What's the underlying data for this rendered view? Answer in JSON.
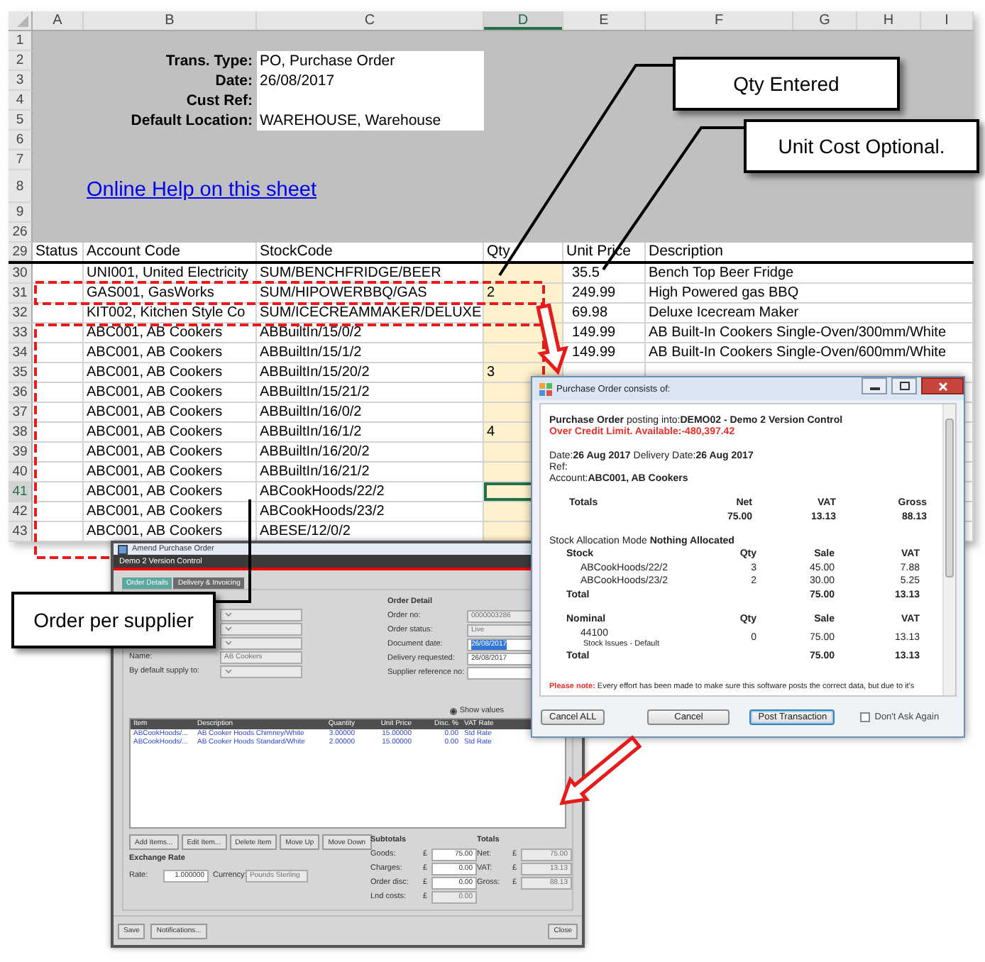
{
  "sheet": {
    "columns": [
      {
        "label": "A",
        "selected": false
      },
      {
        "label": "B",
        "selected": false
      },
      {
        "label": "C",
        "selected": false
      },
      {
        "label": "D",
        "selected": true
      },
      {
        "label": "E",
        "selected": false
      },
      {
        "label": "F",
        "selected": false
      },
      {
        "label": "G",
        "selected": false
      },
      {
        "label": "H",
        "selected": false
      },
      {
        "label": "I",
        "selected": false
      }
    ],
    "top_rows": [
      {
        "number": "1"
      },
      {
        "number": "2",
        "label": "Trans. Type:",
        "value": "PO, Purchase Order"
      },
      {
        "number": "3",
        "label": "Date:",
        "value": "26/08/2017"
      },
      {
        "number": "4",
        "label": "Cust Ref:"
      },
      {
        "number": "5",
        "label": "Default Location:",
        "value": "WAREHOUSE, Warehouse"
      },
      {
        "number": "6"
      },
      {
        "number": "7"
      },
      {
        "number": "8",
        "link": "Online Help on this sheet"
      },
      {
        "number": "9"
      },
      {
        "number": "26"
      }
    ],
    "header": {
      "number": "29",
      "cells": [
        "Status",
        "Account Code",
        "StockCode",
        "Qty",
        "Unit Price",
        "Description"
      ]
    },
    "rows": [
      {
        "number": "30",
        "account": "UNI001, United Electricity",
        "stock": "SUM/BENCHFRIDGE/BEER",
        "price": "35.5",
        "description": "Bench Top Beer Fridge",
        "selected": false
      },
      {
        "number": "31",
        "account": "GAS001, GasWorks",
        "stock": "SUM/HIPOWERBBQ/GAS",
        "qty": "2",
        "price": "249.99",
        "description": "High Powered gas BBQ",
        "selected": false
      },
      {
        "number": "32",
        "account": "KIT002, Kitchen Style Co",
        "stock": "SUM/ICECREAMMAKER/DELUXE",
        "price": "69.98",
        "description": "Deluxe Icecream Maker",
        "selected": false
      },
      {
        "number": "33",
        "account": "ABC001, AB Cookers",
        "stock": "ABBuiltIn/15/0/2",
        "price": "149.99",
        "description": "AB Built-In Cookers Single-Oven/300mm/White",
        "selected": false
      },
      {
        "number": "34",
        "account": "ABC001, AB Cookers",
        "stock": "ABBuiltIn/15/1/2",
        "price": "149.99",
        "description": "AB Built-In Cookers Single-Oven/600mm/White",
        "selected": false
      },
      {
        "number": "35",
        "account": "ABC001, AB Cookers",
        "stock": "ABBuiltIn/15/20/2",
        "qty": "3",
        "selected": false
      },
      {
        "number": "36",
        "account": "ABC001, AB Cookers",
        "stock": "ABBuiltIn/15/21/2",
        "selected": false
      },
      {
        "number": "37",
        "account": "ABC001, AB Cookers",
        "stock": "ABBuiltIn/16/0/2",
        "selected": false
      },
      {
        "number": "38",
        "account": "ABC001, AB Cookers",
        "stock": "ABBuiltIn/16/1/2",
        "qty": "4",
        "selected": false
      },
      {
        "number": "39",
        "account": "ABC001, AB Cookers",
        "stock": "ABBuiltIn/16/20/2",
        "selected": false
      },
      {
        "number": "40",
        "account": "ABC001, AB Cookers",
        "stock": "ABBuiltIn/16/21/2",
        "selected": false
      },
      {
        "number": "41",
        "account": "ABC001, AB Cookers",
        "stock": "ABCookHoods/22/2",
        "selected": true
      },
      {
        "number": "42",
        "account": "ABC001, AB Cookers",
        "stock": "ABCookHoods/23/2",
        "selected": false
      },
      {
        "number": "43",
        "account": "ABC001, AB Cookers",
        "stock": "ABESE/12/0/2",
        "selected": false
      }
    ]
  },
  "callouts": [
    {
      "text": "Qty Entered"
    },
    {
      "text": "Unit Cost Optional."
    },
    {
      "text": "Order per supplier"
    }
  ],
  "amend_window": {
    "title": "Amend Purchase Order",
    "company": "Demo 2 Version Control",
    "tabs": [
      {
        "label": "Order Details",
        "selected": true
      },
      {
        "label": "Delivery & Invoicing",
        "selected": false
      }
    ],
    "supplier_fields": [
      {
        "kind": "dropdown",
        "editable": false
      },
      {
        "kind": "dropdown",
        "editable": false
      },
      {
        "kind": "dropdown",
        "editable": false
      },
      {
        "kind": "text",
        "label": "Name:",
        "value": "AB Cookers",
        "editable": false
      },
      {
        "kind": "dropdown",
        "label": "By default supply to:",
        "editable": false
      }
    ],
    "order_detail": {
      "title": "Order Detail",
      "fields": [
        {
          "label": "Order no:",
          "value": "0000003286",
          "editable": false,
          "text_selected": false
        },
        {
          "label": "Order status:",
          "value": "Live",
          "editable": false,
          "text_selected": false
        },
        {
          "label": "Document date:",
          "value": "26/08/2017",
          "editable": true,
          "text_selected": true
        },
        {
          "label": "Delivery requested:",
          "value": "26/08/2017",
          "editable": true,
          "text_selected": false
        },
        {
          "label": "Supplier reference no:",
          "editable": true,
          "text_selected": false
        }
      ]
    },
    "view_options": [
      {
        "label": "Show values",
        "selected": true
      }
    ],
    "grid": {
      "columns": [
        "Item",
        "Description",
        "Quantity",
        "Unit Price",
        "Disc. %",
        "VAT Rate"
      ],
      "rows": [
        [
          "ABCookHoods/...",
          "AB Cooker Hoods Chimney/White",
          "3.00000",
          "15.00000",
          "0.00",
          "Std Rate"
        ],
        [
          "ABCookHoods/...",
          "AB Cooker Hoods Standard/White",
          "2.00000",
          "15.00000",
          "0.00",
          "Std Rate"
        ]
      ]
    },
    "item_buttons": [
      "Add Items...",
      "Edit Item...",
      "Delete Item",
      "Move Up",
      "Move Down"
    ],
    "exchange_rate": {
      "title": "Exchange Rate",
      "fields": [
        {
          "label": "Rate:",
          "value": "1.000000",
          "editable": true
        },
        {
          "label": "Currency:",
          "value": "Pounds Sterling",
          "editable": false
        }
      ]
    },
    "subtotals": {
      "title": "Subtotals",
      "fields": [
        {
          "label": "Goods:",
          "currency": "£",
          "value": "75.00",
          "editable": true
        },
        {
          "label": "Charges:",
          "currency": "£",
          "value": "0.00",
          "editable": true
        },
        {
          "label": "Order disc:",
          "currency": "£",
          "value": "0.00",
          "editable": true
        },
        {
          "label": "Lnd costs:",
          "currency": "£",
          "value": "0.00",
          "editable": false
        }
      ]
    },
    "totals": {
      "title": "Totals",
      "fields": [
        {
          "label": "Net:",
          "currency": "£",
          "value": "75.00",
          "editable": false
        },
        {
          "label": "VAT:",
          "currency": "£",
          "value": "13.13",
          "editable": false
        },
        {
          "label": "Gross:",
          "currency": "£",
          "value": "88.13",
          "editable": false
        }
      ]
    },
    "footer_buttons": [
      "Save",
      "Notifications...",
      "Close"
    ]
  },
  "posting_dialog": {
    "title": "Purchase Order consists of:",
    "posting": "**Purchase Order** posting into:**DEMO02 - Demo 2 Version Control**",
    "warning": "Over Credit Limit. Available:-480,397.42",
    "dates": "Date:**26 Aug 2017** Delivery Date:**26 Aug 2017**",
    "ref": "Ref:",
    "account": "Account:**ABC001, AB Cookers**",
    "totals": {
      "columns": [
        "Totals",
        "Net",
        "VAT",
        "Gross"
      ],
      "values": [
        "75.00",
        "13.13",
        "88.13"
      ]
    },
    "allocation": "Stock Allocation Mode **Nothing Allocated**",
    "stock": {
      "columns": [
        "Stock",
        "Qty",
        "Sale",
        "VAT"
      ],
      "rows": [
        {
          "name": "ABCookHoods/22/2",
          "qty": "3",
          "sale": "45.00",
          "vat": "7.88"
        },
        {
          "name": "ABCookHoods/23/2",
          "qty": "2",
          "sale": "30.00",
          "vat": "5.25"
        }
      ],
      "total": {
        "label": "Total",
        "sale": "75.00",
        "vat": "13.13"
      }
    },
    "nominal": {
      "columns": [
        "Nominal",
        "Qty",
        "Sale",
        "VAT"
      ],
      "rows": [
        {
          "name": "44100",
          "detail": "Stock Issues - Default",
          "qty": "0",
          "sale": "75.00",
          "vat": "13.13"
        }
      ],
      "total": {
        "label": "Total",
        "sale": "75.00",
        "vat": "13.13"
      }
    },
    "note": {
      "label": "Please note:",
      "text": "Every effort has been made to make sure this software posts the correct data, but due to it's"
    },
    "buttons": [
      {
        "label": "Cancel ALL",
        "default": false
      },
      {
        "label": "Cancel",
        "default": false
      },
      {
        "label": "Post Transaction",
        "default": true
      }
    ],
    "dont_ask": {
      "label": "Don't Ask Again",
      "checked": false
    }
  }
}
